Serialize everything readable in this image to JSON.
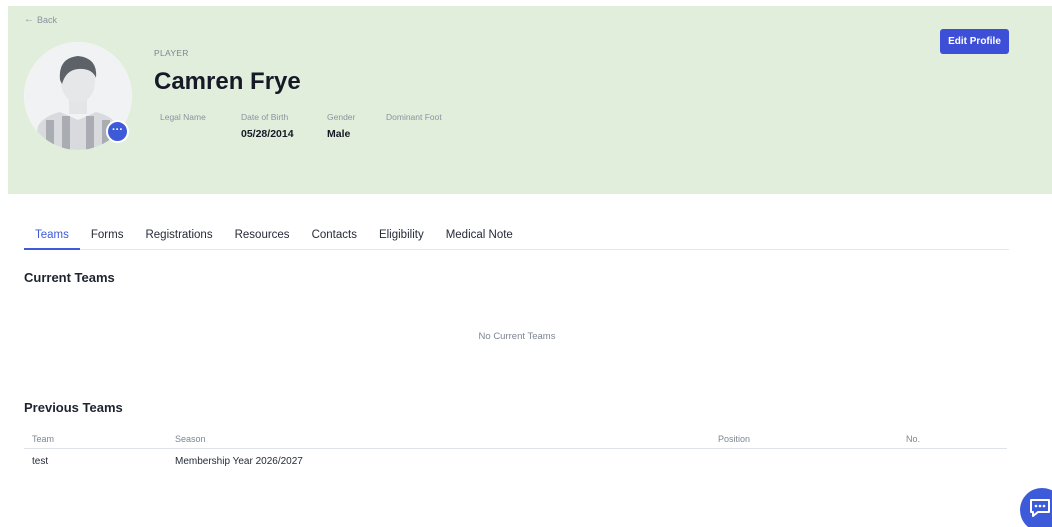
{
  "header": {
    "back_label": "Back",
    "role": "PLAYER",
    "name": "Camren Frye",
    "edit_label": "Edit Profile",
    "avatar_menu_label": "···",
    "fields": {
      "legal_name": {
        "label": "Legal Name",
        "value": ""
      },
      "dob": {
        "label": "Date of Birth",
        "value": "05/28/2014"
      },
      "gender": {
        "label": "Gender",
        "value": "Male"
      },
      "dominant_foot": {
        "label": "Dominant Foot",
        "value": ""
      }
    }
  },
  "tabs": [
    "Teams",
    "Forms",
    "Registrations",
    "Resources",
    "Contacts",
    "Eligibility",
    "Medical Note"
  ],
  "active_tab": "Teams",
  "current_teams": {
    "title": "Current Teams",
    "empty_message": "No Current Teams"
  },
  "previous_teams": {
    "title": "Previous Teams",
    "columns": [
      "Team",
      "Season",
      "Position",
      "No."
    ],
    "rows": [
      [
        "test",
        "Membership Year 2026/2027",
        "",
        ""
      ]
    ]
  },
  "colors": {
    "accent": "#3d5bd9",
    "header_bg": "#e0eedb",
    "button": "#3d4fd6"
  },
  "icons": {
    "back": "arrow-left-icon",
    "avatar_menu": "more-icon",
    "chat": "chat-icon"
  }
}
